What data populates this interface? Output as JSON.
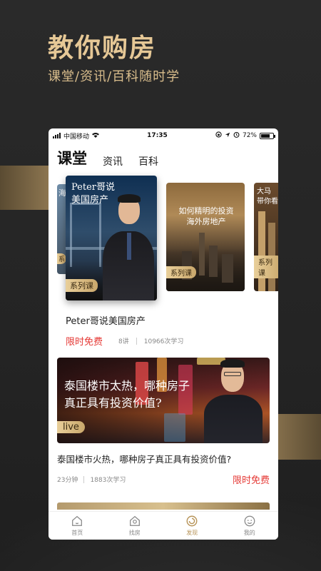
{
  "hero": {
    "title": "教你购房",
    "subtitle": "课堂/资讯/百科随时学"
  },
  "status_bar": {
    "carrier": "中国移动",
    "time": "17:35",
    "battery": "72%",
    "battery_level": 0.72
  },
  "tabs": [
    {
      "label": "课堂",
      "active": true
    },
    {
      "label": "资讯",
      "active": false
    },
    {
      "label": "百科",
      "active": false
    }
  ],
  "carousel": {
    "main": {
      "title_line1": "Peter哥说",
      "title_line2": "美国房产",
      "tag": "系列课"
    },
    "mid": {
      "title_line1": "如何精明的投资",
      "title_line2": "海外房地产",
      "tag": "系列课"
    },
    "right": {
      "title_line1": "大马",
      "title_line2": "带你看",
      "tag": "系列课"
    },
    "left": {
      "text": "海",
      "tag": "系"
    }
  },
  "course": {
    "title": "Peter哥说美国房产",
    "price": "限时免费",
    "lessons": "8讲",
    "learners": "10966次学习"
  },
  "live": {
    "banner_line1": "泰国楼市太热，哪种房子",
    "banner_line2": "真正具有投资价值?",
    "tag": "live",
    "title": "泰国楼市火热，哪种房子真正具有投资价值?",
    "duration": "23分钟",
    "learners": "1883次学习",
    "price": "限时免费"
  },
  "bottom_nav": [
    {
      "label": "首页",
      "icon": "home-icon",
      "active": false
    },
    {
      "label": "找房",
      "icon": "find-house-icon",
      "active": false
    },
    {
      "label": "发现",
      "icon": "discover-icon",
      "active": true
    },
    {
      "label": "我的",
      "icon": "profile-icon",
      "active": false
    }
  ],
  "colors": {
    "accent_gold": "#e6c896",
    "price_red": "#e53935",
    "nav_active": "#b8955a",
    "background": "#262626"
  }
}
